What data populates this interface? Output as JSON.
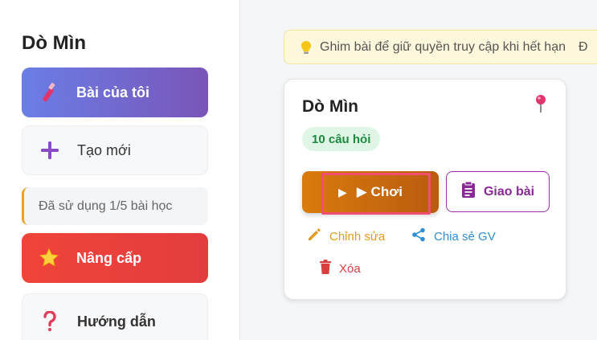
{
  "sidebar": {
    "title": "Dò Mìn",
    "items": [
      {
        "label": "Bài của tôi",
        "icon": "magic-wand-icon"
      },
      {
        "label": "Tạo mới",
        "icon": "plus-icon"
      },
      {
        "label": "Nâng cấp",
        "icon": "star-icon"
      },
      {
        "label": "Hướng dẫn",
        "icon": "question-icon"
      }
    ],
    "usage": "Đã sử dụng 1/5 bài học"
  },
  "notice": {
    "icon": "lightbulb-icon",
    "text": "Ghim bài để giữ quyền truy cập khi hết hạn",
    "trailing": "Đ"
  },
  "card": {
    "title": "Dò Mìn",
    "badge": "10 câu hỏi",
    "play_label": "▶ Chơi",
    "assign_label": "Giao bài",
    "edit_label": "Chỉnh sửa",
    "share_label": "Chia sẻ GV",
    "delete_label": "Xóa"
  },
  "colors": {
    "primary_gradient_start": "#6a7ee6",
    "primary_gradient_end": "#7a55b8",
    "upgrade": "#ef4444",
    "play": "#d97b0c",
    "assign": "#8a2897",
    "badge_text": "#1b8a3c"
  }
}
